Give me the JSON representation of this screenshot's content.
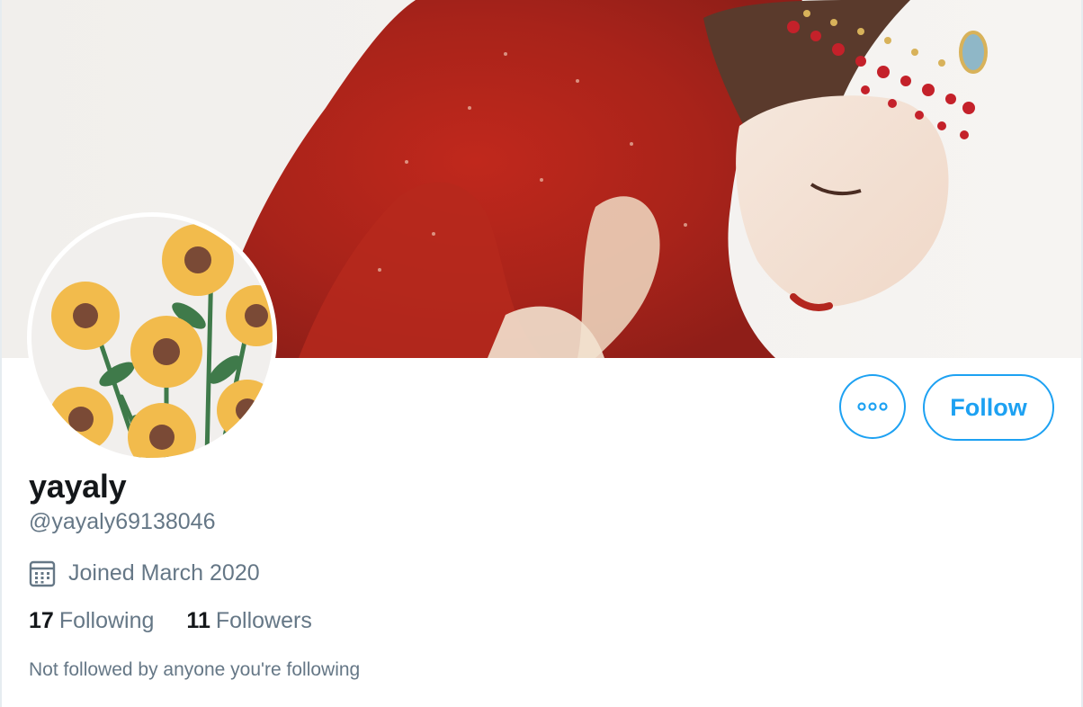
{
  "profile": {
    "display_name": "yayaly",
    "handle": "@yayaly69138046",
    "joined": "Joined March 2020"
  },
  "stats": {
    "following_count": "17",
    "following_label": "Following",
    "followers_count": "11",
    "followers_label": "Followers"
  },
  "mutual_text": "Not followed by anyone you're following",
  "actions": {
    "follow_label": "Follow",
    "more_icon": "more-options-icon"
  },
  "icons": {
    "calendar": "calendar-icon"
  },
  "colors": {
    "accent": "#1da1f2",
    "primary_text": "#14171a",
    "secondary_text": "#657786"
  }
}
